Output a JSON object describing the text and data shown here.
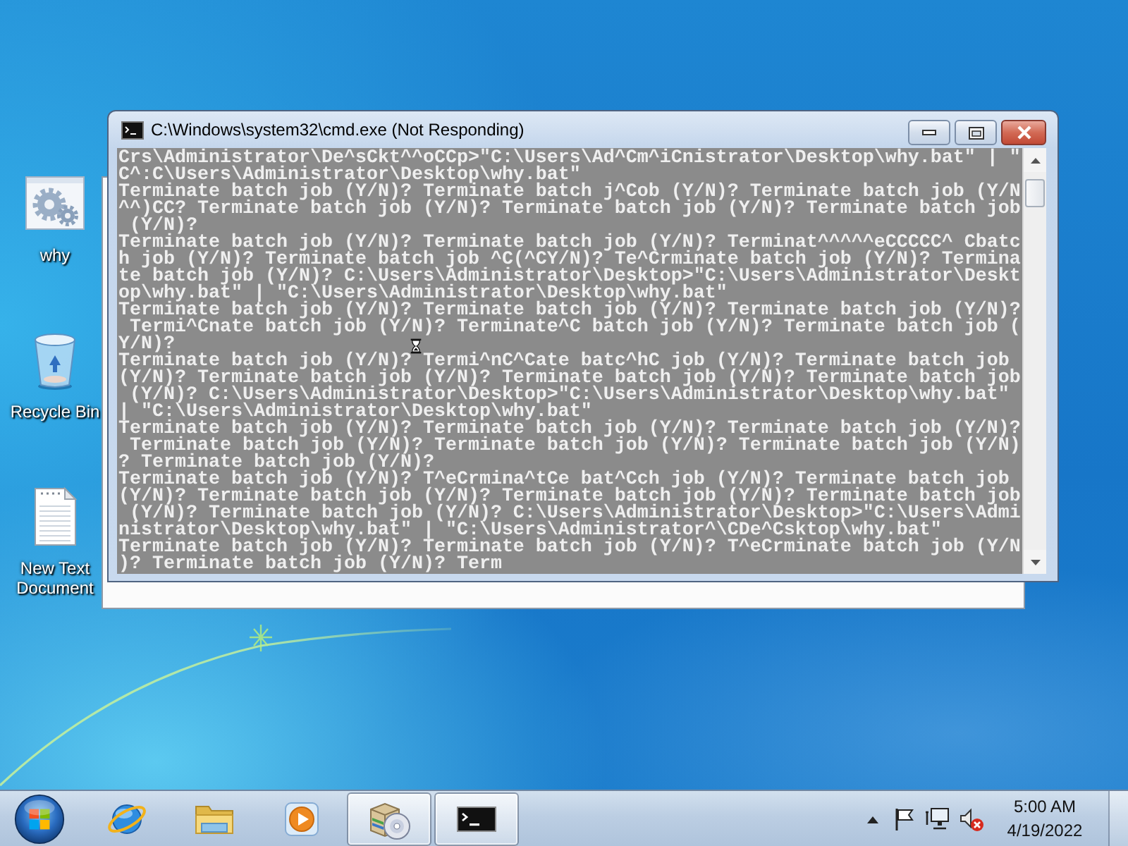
{
  "desktop": {
    "icons": [
      {
        "kind": "batch",
        "label": "why"
      },
      {
        "kind": "recycle",
        "label": "Recycle Bin"
      },
      {
        "kind": "text",
        "label": "New Text Document"
      }
    ]
  },
  "window": {
    "title": "C:\\Windows\\system32\\cmd.exe (Not Responding)",
    "console_lines": [
      "Crs\\Administrator\\De^sCkt^^oCCp>\"C:\\Users\\Ad^Cm^iCnistrator\\Desktop\\why.bat\" | \"",
      "C^:C\\Users\\Administrator\\Desktop\\why.bat\"",
      "Terminate batch job (Y/N)? Terminate batch j^Cob (Y/N)? Terminate batch job (Y/N",
      "^^)CC? Terminate batch job (Y/N)? Terminate batch job (Y/N)? Terminate batch job",
      " (Y/N)?",
      "Terminate batch job (Y/N)? Terminate batch job (Y/N)? Terminat^^^^^eCCCCC^ Cbatc",
      "h job (Y/N)? Terminate batch job ^C(^CY/N)? Te^Crminate batch job (Y/N)? Termina",
      "te batch job (Y/N)? C:\\Users\\Administrator\\Desktop>\"C:\\Users\\Administrator\\Deskt",
      "op\\why.bat\" | \"C:\\Users\\Administrator\\Desktop\\why.bat\"",
      "Terminate batch job (Y/N)? Terminate batch job (Y/N)? Terminate batch job (Y/N)?",
      " Termi^Cnate batch job (Y/N)? Terminate^C batch job (Y/N)? Terminate batch job (",
      "Y/N)?",
      "Terminate batch job (Y/N)? Termi^nC^Cate batc^hC job (Y/N)? Terminate batch job",
      "(Y/N)? Terminate batch job (Y/N)? Terminate batch job (Y/N)? Terminate batch job",
      " (Y/N)? C:\\Users\\Administrator\\Desktop>\"C:\\Users\\Administrator\\Desktop\\why.bat\"",
      "| \"C:\\Users\\Administrator\\Desktop\\why.bat\"",
      "Terminate batch job (Y/N)? Terminate batch job (Y/N)? Terminate batch job (Y/N)?",
      " Terminate batch job (Y/N)? Terminate batch job (Y/N)? Terminate batch job (Y/N)",
      "? Terminate batch job (Y/N)?",
      "Terminate batch job (Y/N)? T^eCrmina^tCe bat^Cch job (Y/N)? Terminate batch job",
      "(Y/N)? Terminate batch job (Y/N)? Terminate batch job (Y/N)? Terminate batch job",
      " (Y/N)? Terminate batch job (Y/N)? C:\\Users\\Administrator\\Desktop>\"C:\\Users\\Admi",
      "nistrator\\Desktop\\why.bat\" | \"C:\\Users\\Administrator^\\CDe^Csktop\\why.bat\"",
      "Terminate batch job (Y/N)? Terminate batch job (Y/N)? T^eCrminate batch job (Y/N",
      ")? Terminate batch job (Y/N)? Term"
    ]
  },
  "taskbar": {
    "apps": [
      {
        "kind": "browser",
        "running": false
      },
      {
        "kind": "explorer",
        "running": false
      },
      {
        "kind": "media",
        "running": false
      },
      {
        "kind": "installer",
        "running": true
      },
      {
        "kind": "console",
        "running": true
      }
    ],
    "tray": {
      "sound_muted": true
    },
    "clock": {
      "time": "5:00 AM",
      "date": "4/19/2022"
    }
  }
}
